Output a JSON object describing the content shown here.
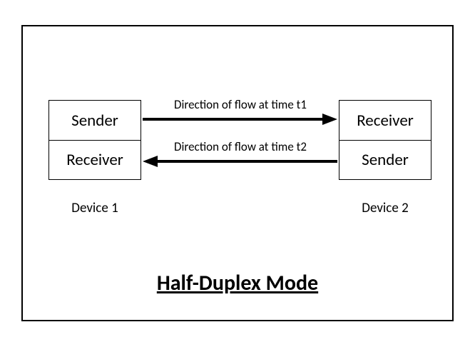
{
  "title": "Half-Duplex Mode",
  "device1": {
    "topCell": "Sender",
    "bottomCell": "Receiver",
    "label": "Device 1"
  },
  "device2": {
    "topCell": "Receiver",
    "bottomCell": "Sender",
    "label": "Device 2"
  },
  "flow": {
    "top": "Direction of flow at time t1",
    "bottom": "Direction of flow at time t2"
  }
}
